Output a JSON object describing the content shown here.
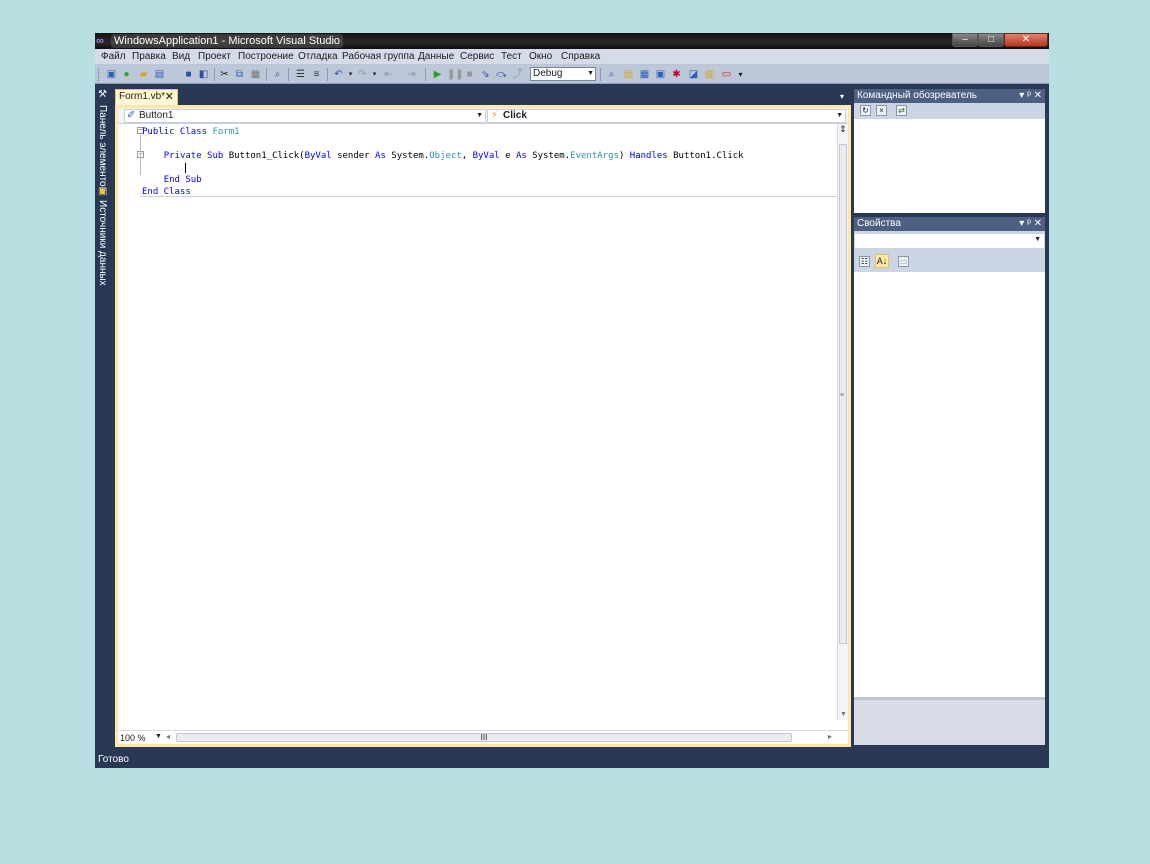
{
  "window": {
    "title": "WindowsApplication1 - Microsoft Visual Studio",
    "minimize": "–",
    "maximize": "□",
    "close": "✕"
  },
  "menu": [
    "Файл",
    "Правка",
    "Вид",
    "Проект",
    "Построение",
    "Отладка",
    "Рабочая группа",
    "Данные",
    "Сервис",
    "Тест",
    "Окно",
    "Справка"
  ],
  "toolbar": {
    "config": "Debug"
  },
  "left_strip": {
    "toolbox": "Панель элементов",
    "datasources": "Источники данных"
  },
  "editor": {
    "tab_label": "Form1.vb*",
    "tab_close": "✕",
    "object_combo": "Button1",
    "event_combo": "Click",
    "zoom": "100 %",
    "hscroll_grip": "III",
    "code": {
      "l1_kw": "Public Class ",
      "l1_name": "Form1",
      "l3_kw1": "Private Sub ",
      "l3_name": "Button1_Click(",
      "l3_byval1": "ByVal",
      "l3_sender": " sender ",
      "l3_as1": "As",
      "l3_sys1": " System.",
      "l3_obj": "Object",
      "l3_comma": ", ",
      "l3_byval2": "ByVal",
      "l3_e": " e ",
      "l3_as2": "As",
      "l3_sys2": " System.",
      "l3_evargs": "EventArgs",
      "l3_close": ") ",
      "l3_handles": "Handles",
      "l3_click": " Button1.Click",
      "l5": "End Sub",
      "l6": "End Class"
    }
  },
  "team_explorer": {
    "title": "Командный обозреватель",
    "controls": "▾ ᵖ ✕"
  },
  "properties": {
    "title": "Свойства",
    "controls": "▾ ᵖ ✕"
  },
  "status": "Готово"
}
